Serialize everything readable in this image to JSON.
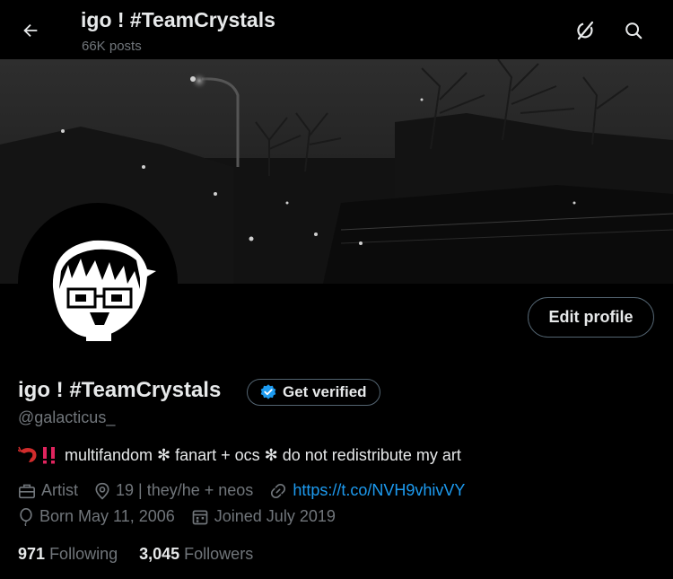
{
  "header": {
    "title": "igo ! #TeamCrystals",
    "post_count": "66K posts"
  },
  "profile": {
    "display_name": "igo ! #TeamCrystals",
    "handle": "@galacticus_",
    "get_verified_label": "Get verified",
    "edit_profile_label": "Edit profile",
    "bio_emojis": "🦐‼️",
    "bio": "multifandom ✻ fanart + ocs ✻ do not redistribute my art",
    "category": "Artist",
    "location": "19 | they/he + neos",
    "website": "https://t.co/NVH9vhivVY",
    "birth": "Born May 11, 2006",
    "joined": "Joined July 2019",
    "following_count": "971",
    "following_label": "Following",
    "followers_count": "3,045",
    "followers_label": "Followers"
  },
  "colors": {
    "background": "#000000",
    "text_primary": "#e7e9ea",
    "text_secondary": "#71767b",
    "link": "#1d9bf0",
    "verified_badge": "#1d9bf0",
    "border": "#536471"
  },
  "icons": [
    "back-arrow-icon",
    "grok-icon",
    "search-icon",
    "verified-badge-icon",
    "briefcase-icon",
    "location-pin-icon",
    "link-icon",
    "balloon-icon",
    "calendar-icon"
  ]
}
